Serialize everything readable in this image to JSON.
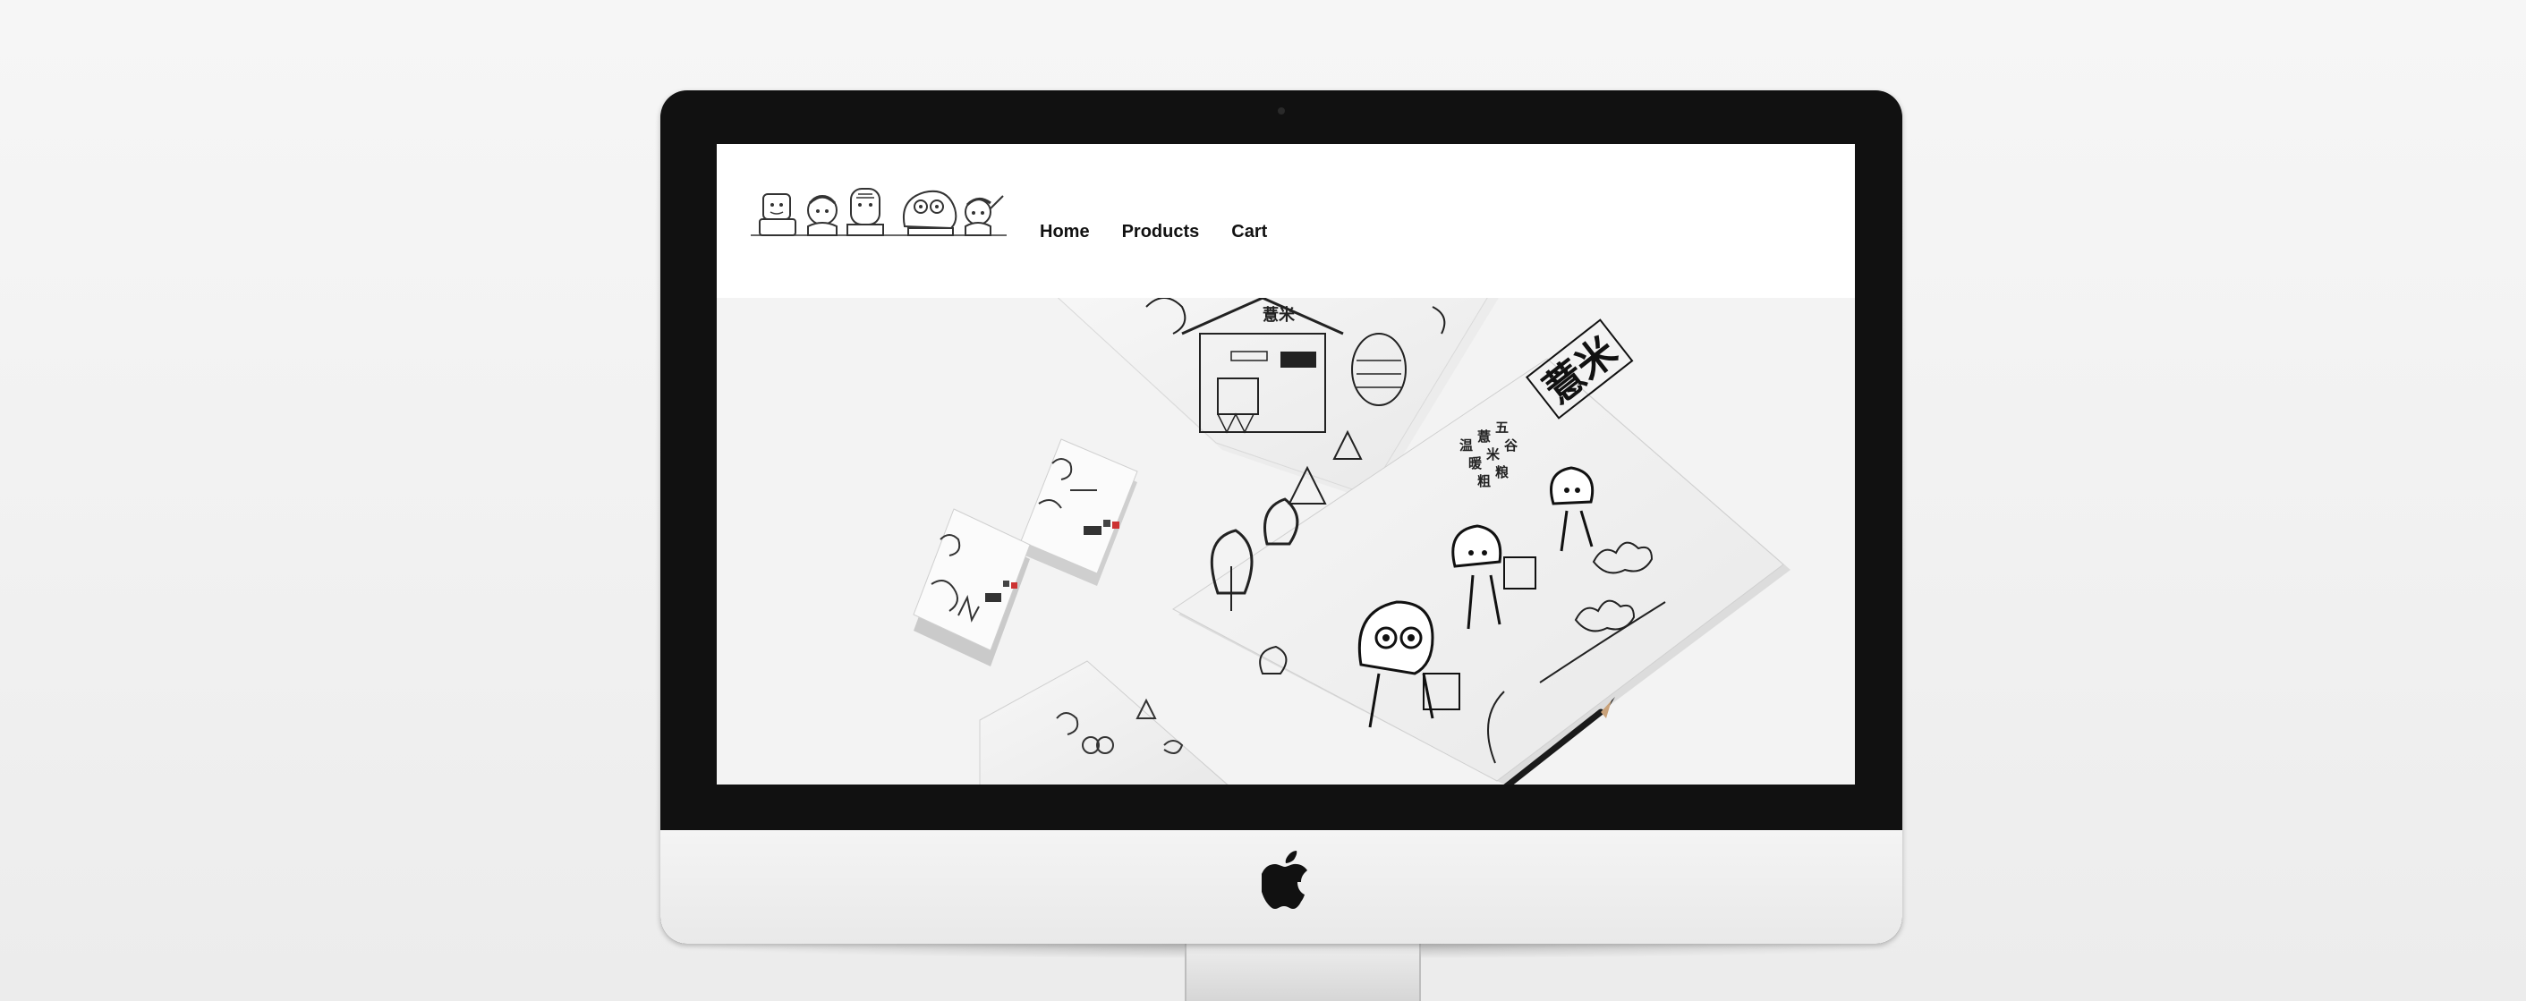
{
  "nav": {
    "items": [
      {
        "label": "Home"
      },
      {
        "label": "Products"
      },
      {
        "label": "Cart"
      }
    ]
  },
  "hero": {
    "poster_title": "薏米",
    "poster_lines": [
      "温",
      "暖",
      "薏",
      "米",
      "五",
      "谷",
      "粗",
      "粮"
    ]
  },
  "colors": {
    "bezel": "#111111",
    "screen_bg": "#ffffff",
    "hero_bg": "#f3f3f3",
    "nav_text": "#111111"
  },
  "icons": {
    "device_logo": "apple-icon",
    "site_logo": "mascot-illustration"
  }
}
